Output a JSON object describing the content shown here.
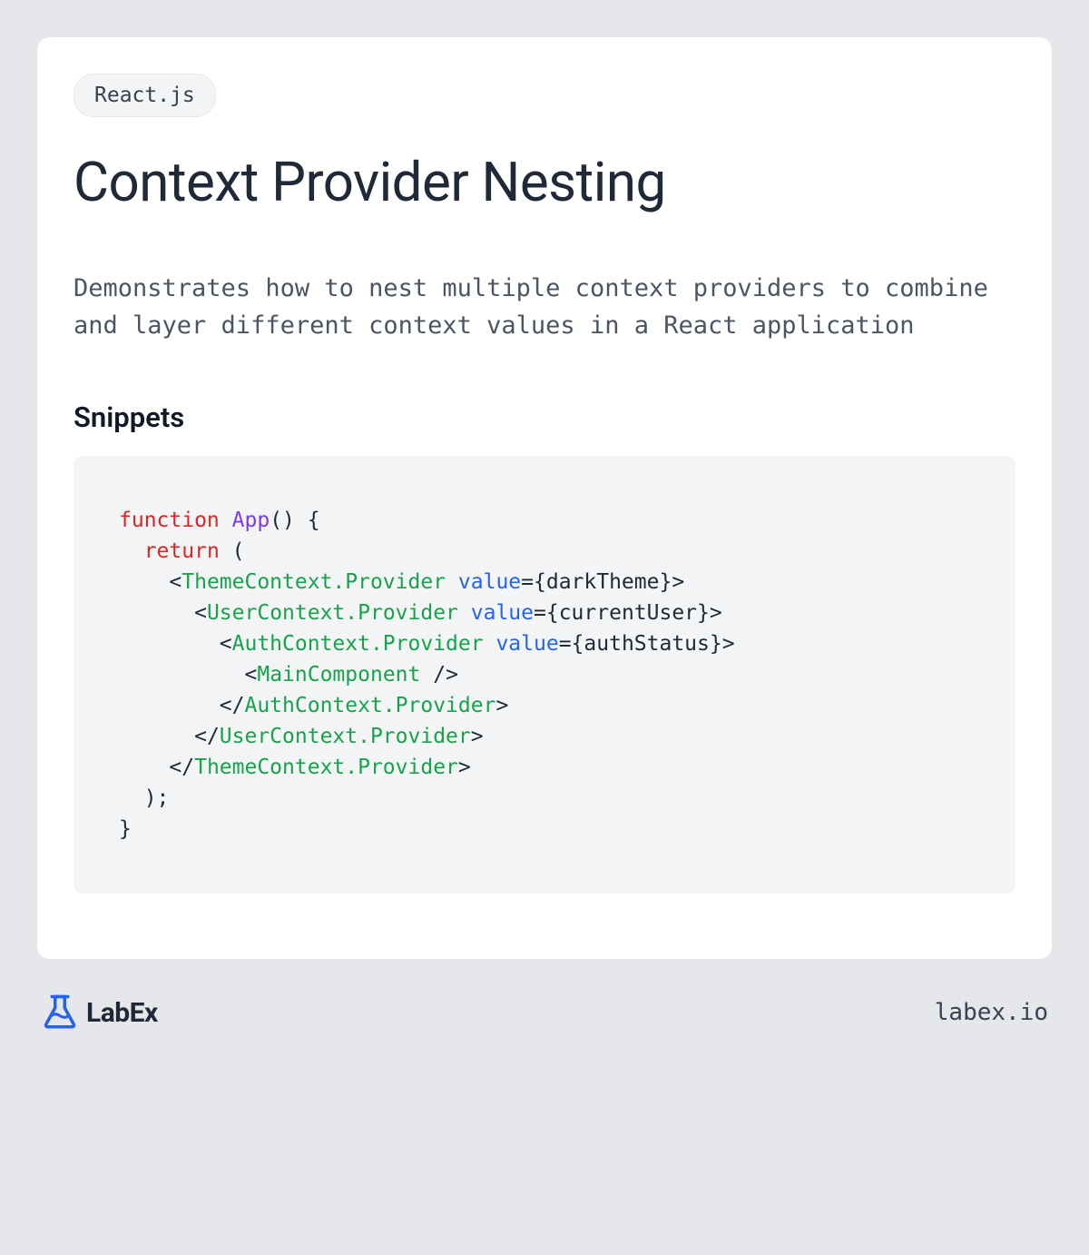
{
  "tag": "React.js",
  "title": "Context Provider Nesting",
  "description": "Demonstrates how to nest multiple context providers to combine and layer different context values in a React application",
  "section_heading": "Snippets",
  "code": {
    "kw_function": "function",
    "fn_name": "App",
    "fn_parens": "() {",
    "kw_return": "return",
    "ret_paren": " (",
    "open1_tag": "ThemeContext.Provider",
    "open1_attr": "value",
    "open1_val": "={darkTheme}",
    "open2_tag": "UserContext.Provider",
    "open2_attr": "value",
    "open2_val": "={currentUser}",
    "open3_tag": "AuthContext.Provider",
    "open3_attr": "value",
    "open3_val": "={authStatus}",
    "self_tag": "MainComponent",
    "close3_tag": "AuthContext.Provider",
    "close2_tag": "UserContext.Provider",
    "close1_tag": "ThemeContext.Provider",
    "end_paren": ");",
    "end_brace": "}"
  },
  "brand": "LabEx",
  "domain": "labex.io"
}
